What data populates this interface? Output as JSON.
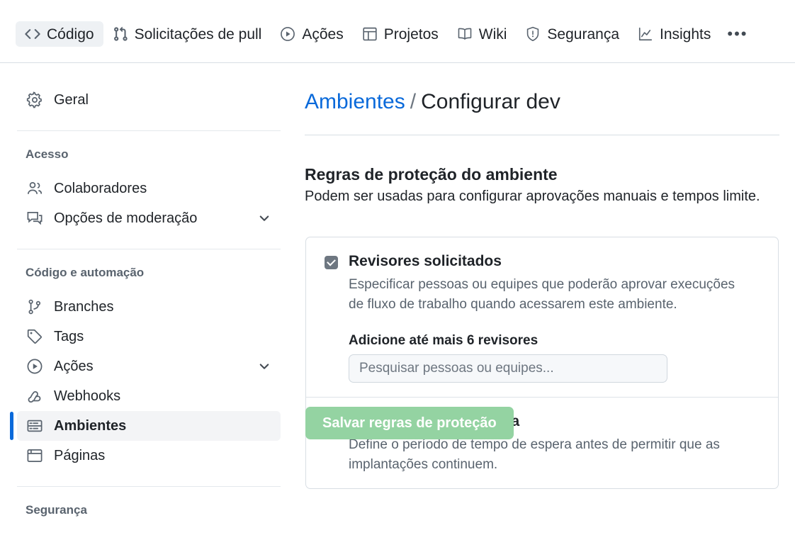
{
  "topnav": {
    "items": [
      {
        "label": "Código",
        "icon": "code-icon",
        "selected": true
      },
      {
        "label": "Solicitações de pull",
        "icon": "git-pull-request-icon",
        "selected": false
      },
      {
        "label": "Ações",
        "icon": "play-circle-icon",
        "selected": false
      },
      {
        "label": "Projetos",
        "icon": "table-icon",
        "selected": false
      },
      {
        "label": "Wiki",
        "icon": "book-icon",
        "selected": false
      },
      {
        "label": "Segurança",
        "icon": "shield-alert-icon",
        "selected": false
      },
      {
        "label": "Insights",
        "icon": "graph-line-icon",
        "selected": false
      }
    ],
    "overflow_label": "•••"
  },
  "sidebar": {
    "items": [
      {
        "label": "Geral",
        "icon": "gear-icon",
        "type": "link",
        "active": false,
        "chevron": false
      },
      {
        "label": "Acesso",
        "type": "group"
      },
      {
        "label": "Colaboradores",
        "icon": "people-icon",
        "type": "link",
        "active": false,
        "chevron": false
      },
      {
        "label": "Opções de moderação",
        "icon": "comment-discussion-icon",
        "type": "link",
        "active": false,
        "chevron": true
      },
      {
        "label": "Código e automação",
        "type": "group"
      },
      {
        "label": "Branches",
        "icon": "git-branch-icon",
        "type": "link",
        "active": false,
        "chevron": false
      },
      {
        "label": "Tags",
        "icon": "tag-icon",
        "type": "link",
        "active": false,
        "chevron": false
      },
      {
        "label": "Ações",
        "icon": "play-circle-icon",
        "type": "link",
        "active": false,
        "chevron": true
      },
      {
        "label": "Webhooks",
        "icon": "webhook-icon",
        "type": "link",
        "active": false,
        "chevron": false
      },
      {
        "label": "Ambientes",
        "icon": "server-icon",
        "type": "link",
        "active": true,
        "chevron": false
      },
      {
        "label": "Páginas",
        "icon": "browser-icon",
        "type": "link",
        "active": false,
        "chevron": false
      },
      {
        "label": "Segurança",
        "type": "group"
      }
    ]
  },
  "main": {
    "breadcrumb": {
      "parent": "Ambientes",
      "separator": "/",
      "current": "Configurar dev"
    },
    "section": {
      "title": "Regras de proteção do ambiente",
      "description": "Podem ser usadas para configurar aprovações manuais e tempos limite."
    },
    "rules": [
      {
        "title": "Revisores solicitados",
        "checked": true,
        "description": "Especificar pessoas ou equipes que poderão aprovar execuções de fluxo de trabalho quando acessarem este ambiente.",
        "field_label": "Adicione até mais 6 revisores",
        "field_placeholder": "Pesquisar pessoas ou equipes...",
        "field_value": ""
      },
      {
        "title": "Temporizador de espera",
        "checked": false,
        "description": "Define o período de tempo de espera antes de permitir que as implantações continuem."
      }
    ],
    "save_button": "Salvar regras de proteção"
  },
  "colors": {
    "accent": "#0969da",
    "save_button_bg": "#94d3a2",
    "selected_nav_bg": "#eef1f4",
    "active_sidebar_bg": "#f3f4f6"
  }
}
